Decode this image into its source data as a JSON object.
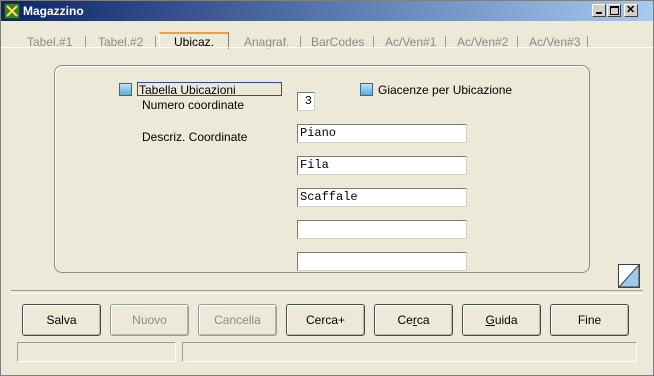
{
  "window": {
    "title": "Magazzino"
  },
  "tabs": [
    {
      "label": "Tabel.#1"
    },
    {
      "label": "Tabel.#2"
    },
    {
      "label": "Ubicaz."
    },
    {
      "label": "Anagraf."
    },
    {
      "label": "BarCodes"
    },
    {
      "label": "Ac/Ven#1"
    },
    {
      "label": "Ac/Ven#2"
    },
    {
      "label": "Ac/Ven#3"
    }
  ],
  "form": {
    "tabella_ubicazioni_label": "Tabella Ubicazioni",
    "giacenze_label": "Giacenze per Ubicazione",
    "numero_coordinate_label": "Numero coordinate",
    "numero_coordinate_value": "3",
    "descriz_label": "Descriz. Coordinate",
    "coordinates": [
      "Piano",
      "Fila",
      "Scaffale",
      "",
      ""
    ]
  },
  "buttons": {
    "salva": "Salva",
    "nuovo": "Nuovo",
    "cancella": "Cancella",
    "cerca_plus": "Cerca+",
    "cerca_pre": "Ce",
    "cerca_mnemonic": "r",
    "cerca_post": "ca",
    "guida_mnemonic": "G",
    "guida_post": "uida",
    "fine": "Fine"
  },
  "colors": {
    "title_start": "#0a246a",
    "title_end": "#a6caf0",
    "active_tab_accent": "#f0a030"
  }
}
